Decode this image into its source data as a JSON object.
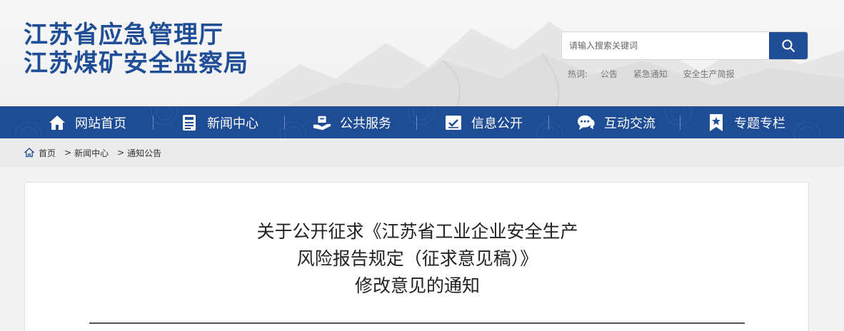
{
  "header": {
    "logo_line1": "江苏省应急管理厅",
    "logo_line2": "江苏煤矿安全监察局",
    "search": {
      "placeholder": "请输入搜索关键词",
      "value": ""
    },
    "hotwords": {
      "label": "热词:",
      "items": [
        "公告",
        "紧急通知",
        "安全生产简报"
      ]
    }
  },
  "nav": {
    "items": [
      {
        "label": "网站首页",
        "icon": "home-icon"
      },
      {
        "label": "新闻中心",
        "icon": "news-icon"
      },
      {
        "label": "公共服务",
        "icon": "public-service-icon"
      },
      {
        "label": "信息公开",
        "icon": "info-disclosure-icon"
      },
      {
        "label": "互动交流",
        "icon": "chat-bubbles-icon"
      },
      {
        "label": "专题专栏",
        "icon": "bookmark-star-icon"
      }
    ]
  },
  "breadcrumb": {
    "items": [
      "首页",
      "新闻中心",
      "通知公告"
    ],
    "separator": ">"
  },
  "article": {
    "title_line1": "关于公开征求《江苏省工业企业安全生产",
    "title_line2": "风险报告规定（征求意见稿）》",
    "title_line3": "修改意见的通知"
  },
  "colors": {
    "brand_blue": "#1f4e96",
    "nav_bg": "#1f4d95",
    "breadcrumb_bg": "#ebebeb",
    "page_bg": "#f3f3f3"
  }
}
